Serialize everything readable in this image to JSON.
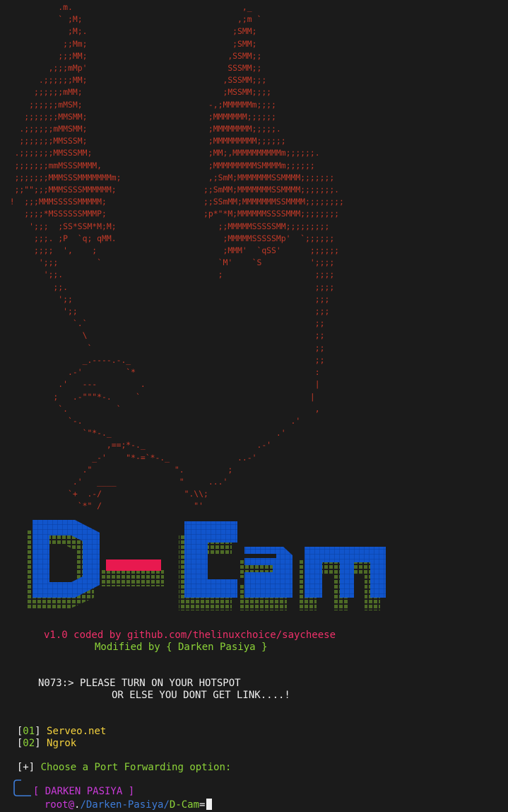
{
  "ascii_art": "            .m.                                   ,_\n            ` ;M;                                ,;m `\n              ;M;.                              ;SMM;\n             ;;Mm;                              ;SMM;\n            ;;;MM;                             ,SSMM;;\n          ,;;;mMp'                             SSSMM;;\n        .;;;;;;MM;                            ,SSSMM;;;\n       ;;;;;;mMM;                             ;MSSMM;;;;\n      ;;;;;;mMSM;                          -,;MMMMMMm;;;;\n     ;;;;;;;MMSMM;                         ;MMMMMMM;;;;;;\n    .;;;;;;mMMSMM;                         ;MMMMMMMM;;;;;.\n    ;;;;;;;MMSSSM;                         ;MMMMMMMMM;;;;;;\n   .;;;;;;;MMSSSMM;                        ;MM;,MMMMMMMMMMm;;;;;;.\n   ;;;;;;;mmMSSSMMMM,                      ;MMMMMMMMMSMMMMm;;;;;;\n   ;;;;;;;MMMSSSMMMMMMMm;                  ,;SmM;MMMMMMMSSMMMM;;;;;;;\n   ;;\"\";;;MMMSSSSMMMMMM;                  ;;SmMM;MMMMMMMSSMMMM;;;;;;;.\n  !  ;;;MMMSSSSSMMMMM;                    ;;SSmMM;MMMMMMMSSMMMM;;;;;;;;\n     ;;;;*MSSSSSSMMMP;                    ;p*\"*M;MMMMMMSSSSMMM;;;;;;;;\n      ';;;  ;SS*SSM*M;M;                     ;;MMMMMSSSSSMM;;;;;;;;;\n       ;;;. ;P  `q; qMM.                      ;MMMMMSSSSSMp'  `;;;;;;\n       ;;;;  ',    ;                          ;MMM'  `qSS'      ;;;;;;\n        ';;;        `                        `M'    `S          ';;;;\n         ';;.                                ;                   ;;;;\n           ;;.                                                   ;;;;\n            ';;                                                  ;;;\n             ';;                                                 ;;;\n               `.`                                               ;;\n                 \\                                               ;;\n                  `                                              ;;\n                 _.----.-._                                      ;;\n              .-'         `*                                     :\n            .'   ---         .                                   |\n           ;   .-\"\"\"*-.     `                                   |\n            `.          `                                        ,\n              `-.                                           .'\n                 `\"*-._                                  .'\n                      ,==;*-._                       .-'\n                   _-'    \"*-=`*-._              ..-'\n                 .\"                 \".         ;\n               .'   ____             \"     ...'\n              `+  .-/                 \".\\\\;\n                `*\" /                   \"'",
  "logo": {
    "text": "D-Cam"
  },
  "credit": {
    "version_line": "v1.0 coded by github.com/thelinuxchoice/saycheese",
    "modified_line": "Modified by { Darken Pasiya }"
  },
  "notice": {
    "line1": "N073:> PLEASE TURN ON YOUR HOTSPOT",
    "line2": "OR ELSE YOU DONT GET LINK....!"
  },
  "options": [
    {
      "number": "01",
      "label": "Serveo.net"
    },
    {
      "number": "02",
      "label": "Ngrok"
    }
  ],
  "prompt": {
    "marker": "+",
    "text": "Choose a Port Forwarding option:"
  },
  "shell": {
    "name": "DARKEN PASIYA",
    "user": "root@",
    "path_prefix": ".",
    "path_mid": "/Darken-Pasiya/",
    "path_end": "D-Cam",
    "suffix": "="
  },
  "colors": {
    "background": "#1b1b1b",
    "art_red": "#c23a28",
    "logo_blue": "#1155cc",
    "logo_red": "#e8194f",
    "logo_shadow": "#4e6b26",
    "credit_red": "#f0306a",
    "credit_green": "#8cd338",
    "option_yellow": "#f4d23e",
    "shell_magenta": "#c93ad8",
    "shell_blue": "#3e7cd8"
  }
}
